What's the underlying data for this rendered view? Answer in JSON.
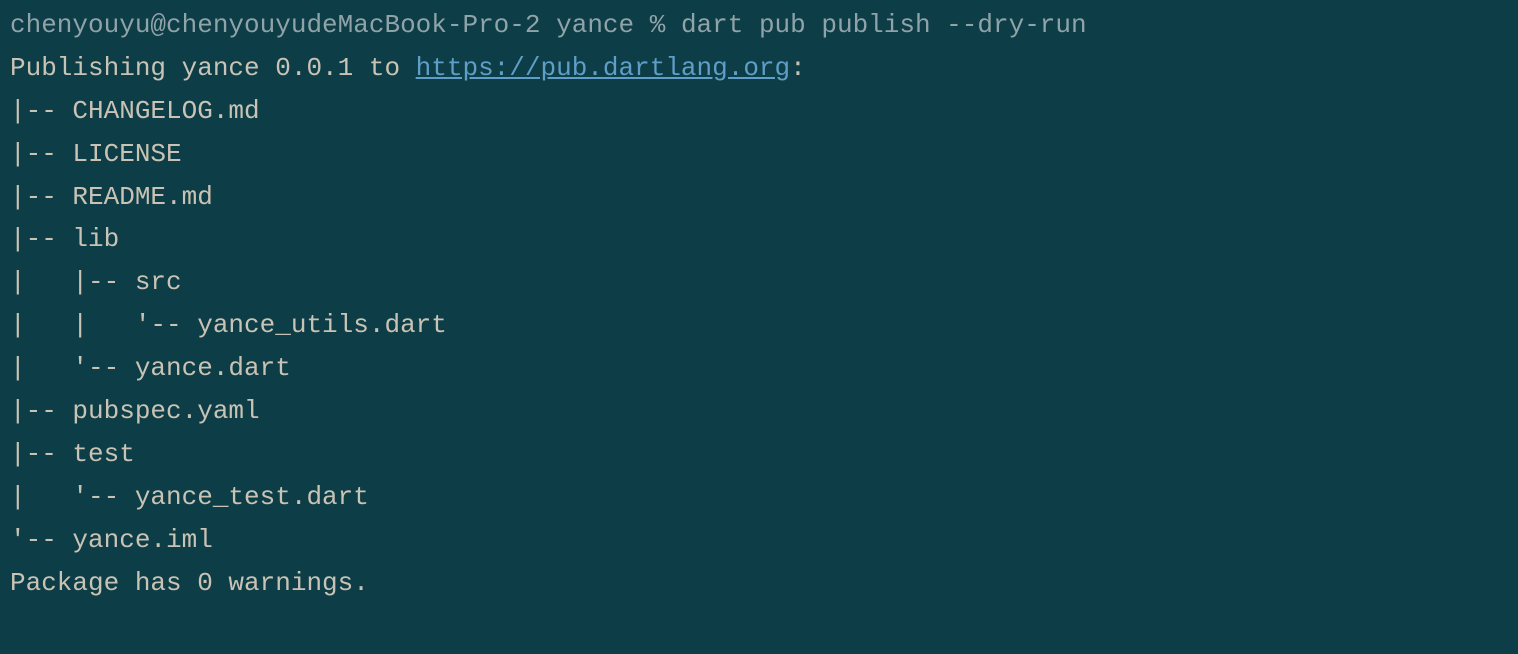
{
  "prompt": {
    "user_host": "chenyouyu@chenyouyudeMacBook-Pro-2",
    "directory": "yance",
    "separator": " % ",
    "command": "dart pub publish --dry-run"
  },
  "publishing": {
    "prefix": "Publishing yance 0.0.1 to ",
    "url": "https://pub.dartlang.org",
    "suffix": ":"
  },
  "tree": {
    "lines": [
      "|-- CHANGELOG.md",
      "|-- LICENSE",
      "|-- README.md",
      "|-- lib",
      "|   |-- src",
      "|   |   '-- yance_utils.dart",
      "|   '-- yance.dart",
      "|-- pubspec.yaml",
      "|-- test",
      "|   '-- yance_test.dart",
      "'-- yance.iml"
    ]
  },
  "footer": {
    "blank": "",
    "warnings": "Package has 0 warnings."
  }
}
